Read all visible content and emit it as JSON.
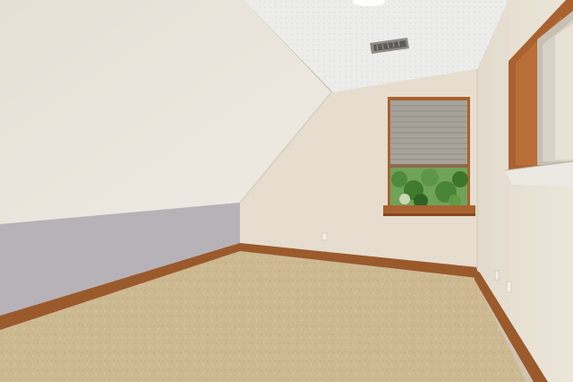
{
  "scene": {
    "kind": "interior photograph",
    "colors": {
      "sloped_ceiling": "#e9e5dc",
      "flat_ceiling": "#ececea",
      "back_wall": "#e6ddcf",
      "right_wall": "#e8e1d4",
      "lower_left_wall": "#b7b2b8",
      "floor": "#cdb991",
      "baseboard": "#9a5a2c",
      "window_trim": "#a9622f",
      "blind": "#a7a39b",
      "foliage": "#4f8a3b"
    }
  }
}
